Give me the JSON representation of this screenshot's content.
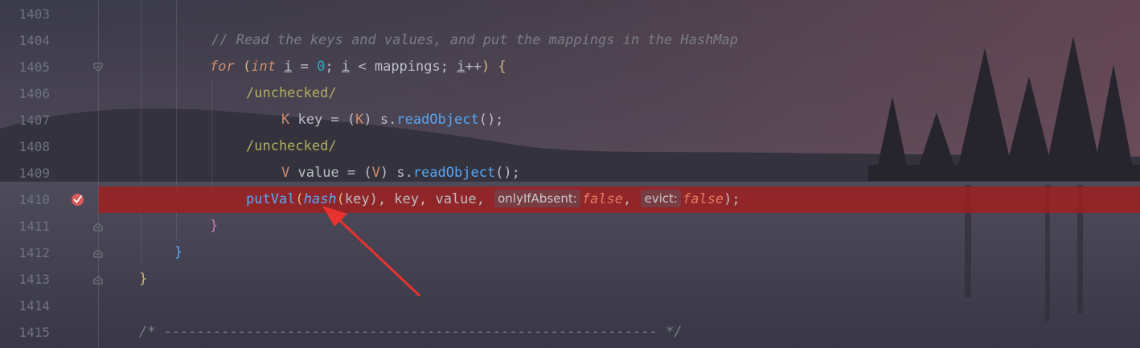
{
  "editor": {
    "lines": [
      {
        "num": "1403"
      },
      {
        "num": "1404",
        "comment": "// Read the keys and values, and put the mappings in the HashMap"
      },
      {
        "num": "1405",
        "kw_for": "for",
        "kw_int": "int",
        "var_i": "i",
        "eq": " = ",
        "zero": "0",
        "semi": "; ",
        "lt": " < mappings; ",
        "inc": "++",
        "close": ") {"
      },
      {
        "num": "1406",
        "annotation": "/unchecked/"
      },
      {
        "num": "1407",
        "type": "K",
        "rest1": " key = (",
        "cast": "K",
        "rest2": ") s.",
        "call": "readObject",
        "end": "();"
      },
      {
        "num": "1408",
        "annotation": "/unchecked/"
      },
      {
        "num": "1409",
        "type": "V",
        "rest1": " value = (",
        "cast": "V",
        "rest2": ") s.",
        "call": "readObject",
        "end": "();"
      },
      {
        "num": "1410",
        "fn": "putVal",
        "hashfn": "hash",
        "args1": "key), key, value, ",
        "hint1": "onlyIfAbsent:",
        "val1": "false",
        "sep": ", ",
        "hint2": "evict:",
        "val2": "false",
        "end": ");"
      },
      {
        "num": "1411",
        "brace": "}"
      },
      {
        "num": "1412",
        "brace": "}"
      },
      {
        "num": "1413",
        "brace": "}"
      },
      {
        "num": "1414"
      },
      {
        "num": "1415",
        "comment": "/* ------------------------------------------------------------ */"
      }
    ]
  },
  "colors": {
    "breakpoint_line": "#a01e1e",
    "breakpoint_marker": "#db5c5c",
    "arrow": "#e8322f"
  },
  "icons": {
    "breakpoint": "breakpoint-check-icon",
    "fold": "fold-marker-icon"
  }
}
